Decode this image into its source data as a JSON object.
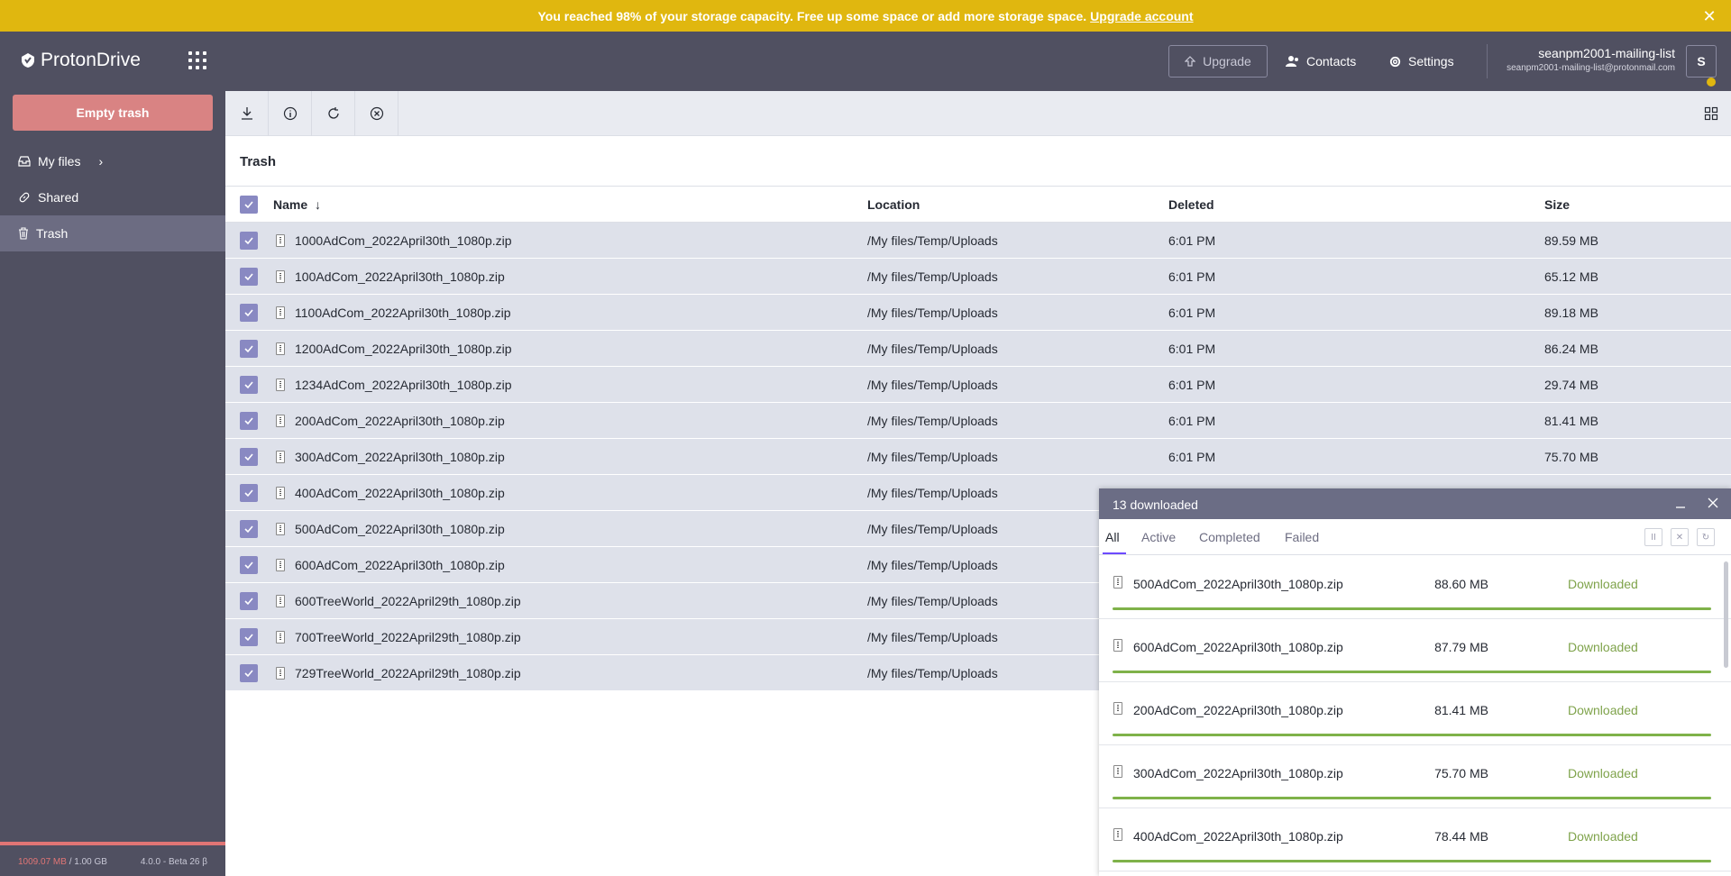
{
  "banner": {
    "message": "You reached 98% of your storage capacity. Free up some space or add more storage space.",
    "link": "Upgrade account",
    "close_icon": "close-icon"
  },
  "header": {
    "logo_text": "ProtonDrive",
    "upgrade_label": "Upgrade",
    "contacts_label": "Contacts",
    "settings_label": "Settings",
    "user_name": "seanpm2001-mailing-list",
    "user_email": "seanpm2001-mailing-list@protonmail.com",
    "avatar_initial": "S",
    "colors": {
      "banner": "#e0b70f",
      "header": "#505061"
    }
  },
  "sidebar": {
    "empty_trash_label": "Empty trash",
    "items": [
      {
        "label": "My files",
        "icon": "inbox-icon"
      },
      {
        "label": "Shared",
        "icon": "link-icon"
      },
      {
        "label": "Trash",
        "icon": "trash-icon"
      }
    ],
    "storage_used": "1009.07 MB",
    "storage_total": "/ 1.00 GB",
    "version": "4.0.0 - Beta 26 β"
  },
  "toolbar": {
    "buttons": [
      "download-icon",
      "info-icon",
      "restore-icon",
      "delete-permanently-icon"
    ],
    "view_toggle": "grid-view-icon"
  },
  "main": {
    "title": "Trash",
    "columns": {
      "name": "Name",
      "location": "Location",
      "deleted": "Deleted",
      "size": "Size"
    },
    "rows": [
      {
        "name": "1000AdCom_2022April30th_1080p.zip",
        "location": "/My files/Temp/Uploads",
        "deleted": "6:01 PM",
        "size": "89.59 MB"
      },
      {
        "name": "100AdCom_2022April30th_1080p.zip",
        "location": "/My files/Temp/Uploads",
        "deleted": "6:01 PM",
        "size": "65.12 MB"
      },
      {
        "name": "1100AdCom_2022April30th_1080p.zip",
        "location": "/My files/Temp/Uploads",
        "deleted": "6:01 PM",
        "size": "89.18 MB"
      },
      {
        "name": "1200AdCom_2022April30th_1080p.zip",
        "location": "/My files/Temp/Uploads",
        "deleted": "6:01 PM",
        "size": "86.24 MB"
      },
      {
        "name": "1234AdCom_2022April30th_1080p.zip",
        "location": "/My files/Temp/Uploads",
        "deleted": "6:01 PM",
        "size": "29.74 MB"
      },
      {
        "name": "200AdCom_2022April30th_1080p.zip",
        "location": "/My files/Temp/Uploads",
        "deleted": "6:01 PM",
        "size": "81.41 MB"
      },
      {
        "name": "300AdCom_2022April30th_1080p.zip",
        "location": "/My files/Temp/Uploads",
        "deleted": "6:01 PM",
        "size": "75.70 MB"
      },
      {
        "name": "400AdCom_2022April30th_1080p.zip",
        "location": "/My files/Temp/Uploads",
        "deleted": "",
        "size": ""
      },
      {
        "name": "500AdCom_2022April30th_1080p.zip",
        "location": "/My files/Temp/Uploads",
        "deleted": "",
        "size": ""
      },
      {
        "name": "600AdCom_2022April30th_1080p.zip",
        "location": "/My files/Temp/Uploads",
        "deleted": "",
        "size": ""
      },
      {
        "name": "600TreeWorld_2022April29th_1080p.zip",
        "location": "/My files/Temp/Uploads",
        "deleted": "",
        "size": ""
      },
      {
        "name": "700TreeWorld_2022April29th_1080p.zip",
        "location": "/My files/Temp/Uploads",
        "deleted": "",
        "size": ""
      },
      {
        "name": "729TreeWorld_2022April29th_1080p.zip",
        "location": "/My files/Temp/Uploads",
        "deleted": "",
        "size": ""
      }
    ]
  },
  "transfer_manager": {
    "title": "13 downloaded",
    "tabs": [
      "All",
      "Active",
      "Completed",
      "Failed"
    ],
    "items": [
      {
        "name": "500AdCom_2022April30th_1080p.zip",
        "size": "88.60 MB",
        "status": "Downloaded",
        "progress": 1.0
      },
      {
        "name": "600AdCom_2022April30th_1080p.zip",
        "size": "87.79 MB",
        "status": "Downloaded",
        "progress": 1.0
      },
      {
        "name": "200AdCom_2022April30th_1080p.zip",
        "size": "81.41 MB",
        "status": "Downloaded",
        "progress": 1.0
      },
      {
        "name": "300AdCom_2022April30th_1080p.zip",
        "size": "75.70 MB",
        "status": "Downloaded",
        "progress": 1.0
      },
      {
        "name": "400AdCom_2022April30th_1080p.zip",
        "size": "78.44 MB",
        "status": "Downloaded",
        "progress": 1.0
      }
    ]
  }
}
